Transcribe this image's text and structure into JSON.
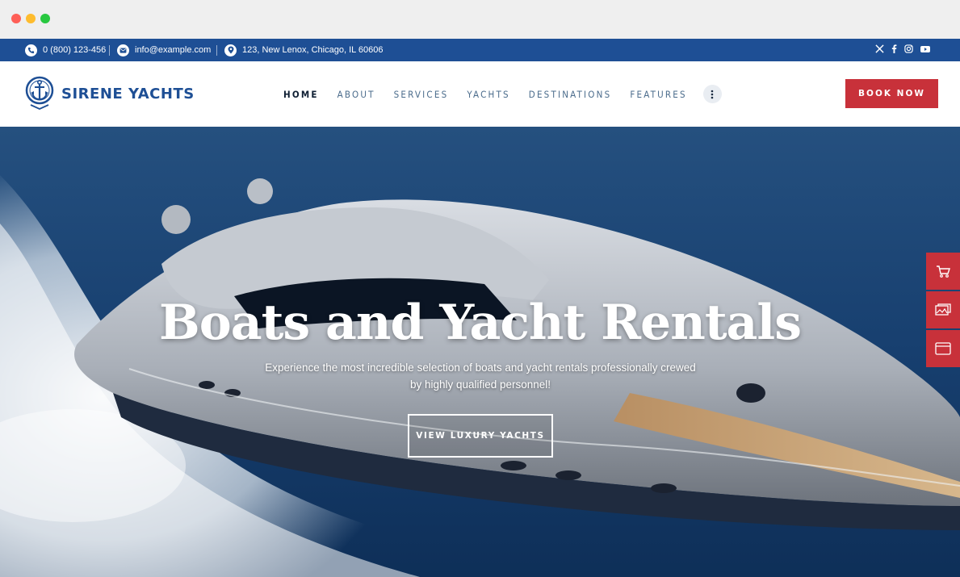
{
  "window": {
    "controls": [
      "close",
      "minimize",
      "maximize"
    ]
  },
  "topbar": {
    "phone": "0 (800) 123-456",
    "email": "info@example.com",
    "address": "123, New Lenox, Chicago, IL 60606",
    "social_icons": [
      "x-icon",
      "facebook-icon",
      "instagram-icon",
      "youtube-icon"
    ]
  },
  "header": {
    "logo_text": "SIRENE YACHTS",
    "nav": [
      {
        "label": "HOME",
        "active": true
      },
      {
        "label": "ABOUT",
        "active": false
      },
      {
        "label": "SERVICES",
        "active": false
      },
      {
        "label": "YACHTS",
        "active": false
      },
      {
        "label": "DESTINATIONS",
        "active": false
      },
      {
        "label": "FEATURES",
        "active": false
      }
    ],
    "book_label": "BOOK NOW"
  },
  "hero": {
    "title": "Boats and Yacht Rentals",
    "subtitle": "Experience the most incredible selection of boats and yacht rentals professionally crewed by highly qualified personnel!",
    "button_label": "VIEW LUXURY YACHTS"
  },
  "side_tabs": [
    "cart-icon",
    "gallery-icon",
    "browser-icon"
  ],
  "colors": {
    "primary_blue": "#1e4f95",
    "accent_red": "#c8313a",
    "nav_text": "#4b6c8c",
    "nav_active": "#0f1f33"
  }
}
